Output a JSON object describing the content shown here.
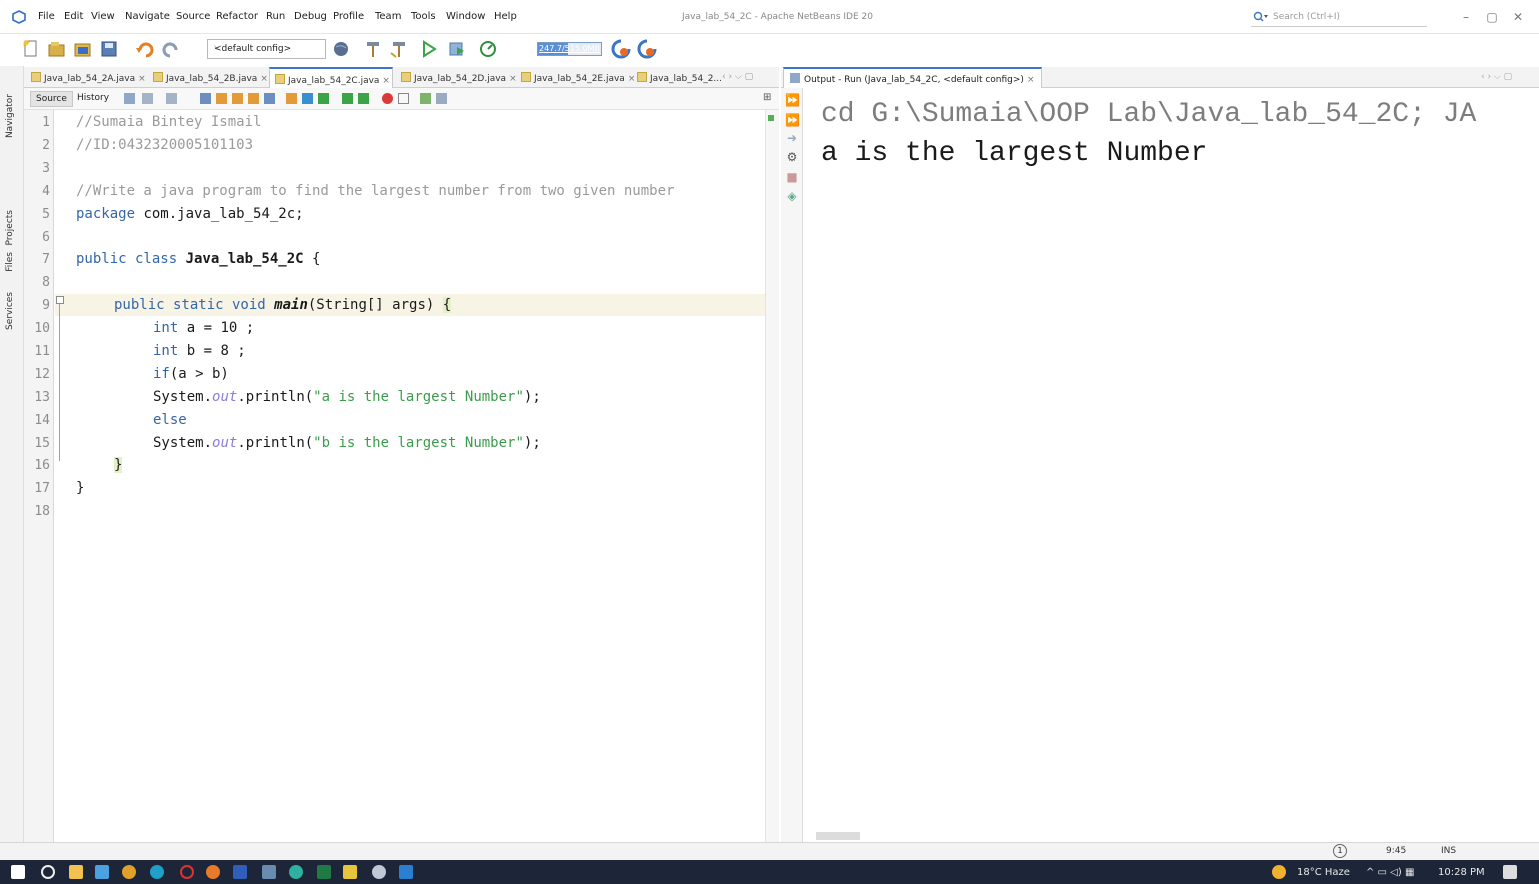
{
  "window": {
    "title": "Java_lab_54_2C - Apache NetBeans IDE 20",
    "menu": [
      "File",
      "Edit",
      "View",
      "Navigate",
      "Source",
      "Refactor",
      "Run",
      "Debug",
      "Profile",
      "Team",
      "Tools",
      "Window",
      "Help"
    ],
    "search_placeholder": "Search (Ctrl+I)",
    "minimize": "–",
    "maximize": "▢",
    "close": "✕"
  },
  "toolbar": {
    "config": "<default config>",
    "memory": "247.7/515.0MB",
    "memory_fraction": 0.48
  },
  "side_tabs": [
    "Navigator",
    "Projects",
    "Files",
    "Services"
  ],
  "editor_tabs": [
    {
      "label": "Java_lab_54_2A.java"
    },
    {
      "label": "Java_lab_54_2B.java"
    },
    {
      "label": "Java_lab_54_2C.java"
    },
    {
      "label": "Java_lab_54_2D.java"
    },
    {
      "label": "Java_lab_54_2E.java"
    },
    {
      "label": "Java_lab_54_2..."
    }
  ],
  "editor": {
    "source_tab": "Source",
    "history_tab": "History",
    "line_numbers": [
      "1",
      "2",
      "3",
      "4",
      "5",
      "6",
      "7",
      "8",
      "9",
      "10",
      "11",
      "12",
      "13",
      "14",
      "15",
      "16",
      "17",
      "18"
    ]
  },
  "code": {
    "l1": "//Sumaia Bintey Ismail",
    "l2": "//ID:0432320005101103",
    "l4": "//Write a java program to find the largest number from two given number",
    "l5_kw": "package",
    "l5_rest": " com.java_lab_54_2c;",
    "l7_kw": "public class ",
    "l7_name": "Java_lab_54_2C",
    "l7_rest": " {",
    "l9_kw": "public static void ",
    "l9_name": "main",
    "l9_rest": "(String[] args) ",
    "l9_brace": "{",
    "l10_kw": "int",
    "l10_rest": " a = 10 ;",
    "l11_kw": "int",
    "l11_rest": " b = 8 ;",
    "l12_kw": "if",
    "l12_rest": "(a > b)",
    "l13_a": "System.",
    "l13_out": "out",
    "l13_b": ".println(",
    "l13_str": "\"a is the largest Number\"",
    "l13_c": ");",
    "l14_kw": "else",
    "l15_a": "System.",
    "l15_out": "out",
    "l15_b": ".println(",
    "l15_str": "\"b is the largest Number\"",
    "l15_c": ");",
    "l16": "}",
    "l17": "}"
  },
  "output": {
    "tab_label": "Output - Run (Java_lab_54_2C, <default config>)",
    "cmd_line": "cd G:\\Sumaia\\OOP Lab\\Java_lab_54_2C; JA",
    "result_line": "a is the largest Number"
  },
  "status": {
    "notification": "1",
    "position": "9:45",
    "mode": "INS"
  },
  "taskbar": {
    "weather": "18°C  Haze",
    "time": "10:28 PM"
  },
  "colors": {
    "keyword": "#3366aa",
    "string": "#3c9c4c",
    "comment": "#9a9a9a",
    "field": "#8a7fd9",
    "accent": "#3a76c4"
  }
}
